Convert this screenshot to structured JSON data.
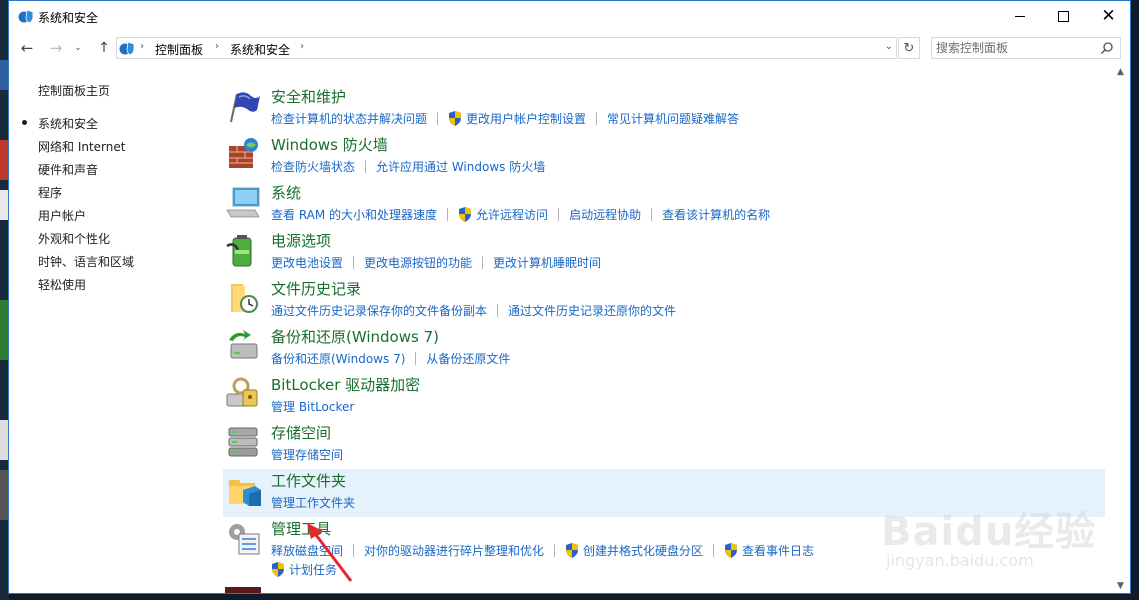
{
  "window": {
    "title": "系统和安全"
  },
  "address": {
    "crumbs": [
      "控制面板",
      "系统和安全"
    ],
    "search_placeholder": "搜索控制面板"
  },
  "leftnav": {
    "home": "控制面板主页",
    "items": [
      "系统和安全",
      "网络和 Internet",
      "硬件和声音",
      "程序",
      "用户帐户",
      "外观和个性化",
      "时钟、语言和区域",
      "轻松使用"
    ],
    "selected": "系统和安全"
  },
  "categories": [
    {
      "title": "安全和维护",
      "icon": "flag-icon",
      "links": [
        {
          "text": "检查计算机的状态并解决问题",
          "shield": false
        },
        {
          "text": "更改用户帐户控制设置",
          "shield": true
        },
        {
          "text": "常见计算机问题疑难解答",
          "shield": false
        }
      ]
    },
    {
      "title": "Windows 防火墙",
      "icon": "firewall-icon",
      "links": [
        {
          "text": "检查防火墙状态",
          "shield": false
        },
        {
          "text": "允许应用通过 Windows 防火墙",
          "shield": false
        }
      ]
    },
    {
      "title": "系统",
      "icon": "computer-icon",
      "links": [
        {
          "text": "查看 RAM 的大小和处理器速度",
          "shield": false
        },
        {
          "text": "允许远程访问",
          "shield": true
        },
        {
          "text": "启动远程协助",
          "shield": false
        },
        {
          "text": "查看该计算机的名称",
          "shield": false
        }
      ]
    },
    {
      "title": "电源选项",
      "icon": "battery-icon",
      "links": [
        {
          "text": "更改电池设置",
          "shield": false
        },
        {
          "text": "更改电源按钮的功能",
          "shield": false
        },
        {
          "text": "更改计算机睡眠时间",
          "shield": false
        }
      ]
    },
    {
      "title": "文件历史记录",
      "icon": "file-history-icon",
      "links": [
        {
          "text": "通过文件历史记录保存你的文件备份副本",
          "shield": false
        },
        {
          "text": "通过文件历史记录还原你的文件",
          "shield": false
        }
      ]
    },
    {
      "title": "备份和还原(Windows 7)",
      "icon": "backup-icon",
      "links": [
        {
          "text": "备份和还原(Windows 7)",
          "shield": false
        },
        {
          "text": "从备份还原文件",
          "shield": false
        }
      ]
    },
    {
      "title": "BitLocker 驱动器加密",
      "icon": "bitlocker-icon",
      "links": [
        {
          "text": "管理 BitLocker",
          "shield": false
        }
      ]
    },
    {
      "title": "存储空间",
      "icon": "storage-icon",
      "links": [
        {
          "text": "管理存储空间",
          "shield": false
        }
      ]
    },
    {
      "title": "工作文件夹",
      "icon": "work-folders-icon",
      "highlighted": true,
      "links": [
        {
          "text": "管理工作文件夹",
          "shield": false
        }
      ]
    },
    {
      "title": "管理工具",
      "icon": "admin-tools-icon",
      "links": [
        {
          "text": "释放磁盘空间",
          "shield": false
        },
        {
          "text": "对你的驱动器进行碎片整理和优化",
          "shield": false
        },
        {
          "text": "创建并格式化硬盘分区",
          "shield": true
        },
        {
          "text": "查看事件日志",
          "shield": true
        }
      ],
      "links_second_row": [
        {
          "text": "计划任务",
          "shield": true
        }
      ]
    }
  ],
  "watermark": {
    "brand": "Baidu经验",
    "site": "jingyan.baidu.com"
  },
  "colors": {
    "title_green": "#1a6e2c",
    "link_blue": "#1767c8",
    "highlight": "#e5f1fb",
    "annotation_arrow": "#e8262d"
  }
}
